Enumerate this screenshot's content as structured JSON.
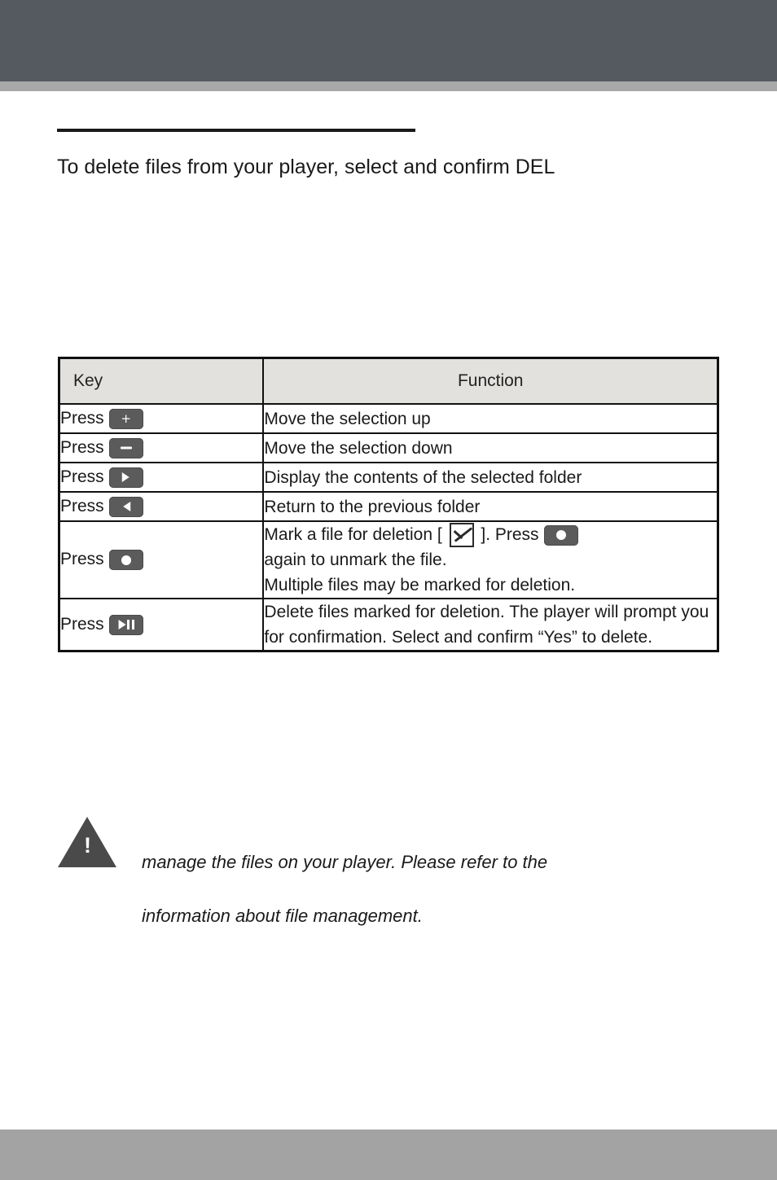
{
  "page": {
    "intro": "To delete files from your player, select and confirm DEL"
  },
  "table": {
    "headers": {
      "key": "Key",
      "function": "Function"
    },
    "rows": [
      {
        "key_prefix": "Press",
        "key_icon": "plus-key-icon",
        "key_glyph": "+",
        "function": "Move the selection up"
      },
      {
        "key_prefix": "Press",
        "key_icon": "minus-key-icon",
        "key_glyph": "–",
        "function": "Move the selection down"
      },
      {
        "key_prefix": "Press",
        "key_icon": "right-arrow-key-icon",
        "key_glyph": "▶",
        "function": "Display the contents of the selected folder"
      },
      {
        "key_prefix": "Press",
        "key_icon": "left-arrow-key-icon",
        "key_glyph": "◀",
        "function": "Return to the previous folder"
      },
      {
        "key_prefix": "Press",
        "key_icon": "record-dot-key-icon",
        "key_glyph": "●",
        "function_part1": "Mark a file for deletion [",
        "function_part2": "]. Press",
        "function_part3": "again to unmark the file.",
        "function_part4": "Multiple files may be marked for deletion."
      },
      {
        "key_prefix": "Press",
        "key_icon": "play-pause-key-icon",
        "key_glyph": "▶‖",
        "function": "Delete files marked for deletion. The player will prompt you for confirmation. Select and confirm “Yes” to delete."
      }
    ]
  },
  "note": {
    "icon": "warning-triangle-icon",
    "exclamation": "!",
    "line1": "manage the files on your player. Please refer to the",
    "line2": "information about file management."
  },
  "colors": {
    "header_band": "#555a61",
    "footer_band": "#a3a3a3",
    "table_header_bg": "#e3e1de",
    "key_button": "#5b5b5b"
  }
}
